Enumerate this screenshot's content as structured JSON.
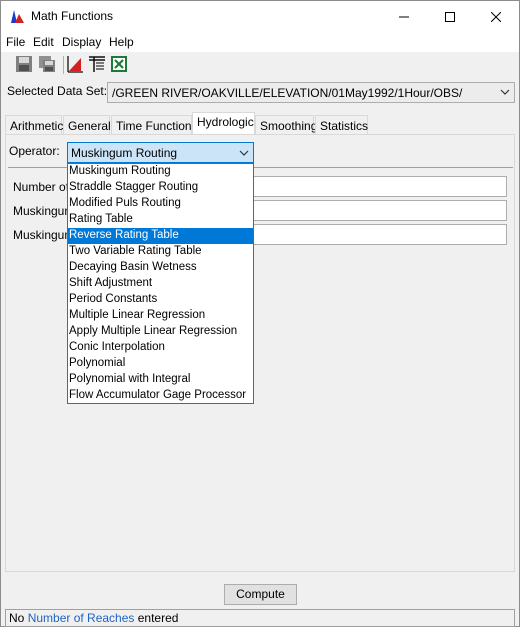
{
  "window": {
    "title": "Math Functions",
    "icon": "hec-dss-app-icon"
  },
  "titlebar_controls": [
    {
      "name": "minimize-button",
      "icon": "minimize-icon"
    },
    {
      "name": "maximize-button",
      "icon": "maximize-icon"
    },
    {
      "name": "close-button",
      "icon": "close-icon"
    }
  ],
  "menu": [
    "File",
    "Edit",
    "Display",
    "Help"
  ],
  "toolbar": [
    {
      "name": "save-button",
      "icon": "save-icon"
    },
    {
      "name": "save-as-button",
      "icon": "save-as-icon"
    },
    {
      "name": "plot-button",
      "icon": "plot-icon"
    },
    {
      "name": "tabulate-button",
      "icon": "table-icon"
    },
    {
      "name": "excel-button",
      "icon": "excel-icon"
    }
  ],
  "dataset": {
    "label": "Selected Data Set:",
    "value": "/GREEN RIVER/OAKVILLE/ELEVATION/01May1992/1Hour/OBS/"
  },
  "tabs": [
    "Arithmetic",
    "General",
    "Time Functions",
    "Hydrologic",
    "Smoothing",
    "Statistics"
  ],
  "active_tab": "Hydrologic",
  "operator": {
    "label": "Operator:",
    "value": "Muskingum Routing"
  },
  "fields": [
    {
      "label": "Number of"
    },
    {
      "label": "Muskingum"
    },
    {
      "label": "Muskingum"
    }
  ],
  "dropdown": {
    "items": [
      "Muskingum Routing",
      "Straddle Stagger Routing",
      "Modified Puls Routing",
      "Rating Table",
      "Reverse Rating Table",
      "Two Variable Rating Table",
      "Decaying Basin Wetness",
      "Shift Adjustment",
      "Period Constants",
      "Multiple Linear Regression",
      "Apply Multiple Linear Regression",
      "Conic Interpolation",
      "Polynomial",
      "Polynomial with Integral",
      "Flow Accumulator Gage Processor"
    ],
    "highlighted": "Reverse Rating Table"
  },
  "compute_label": "Compute",
  "status": {
    "prefix": "No ",
    "link": "Number of Reaches",
    "suffix": " entered"
  },
  "colors": {
    "highlight": "#0078d7",
    "link": "#1e64c8"
  }
}
